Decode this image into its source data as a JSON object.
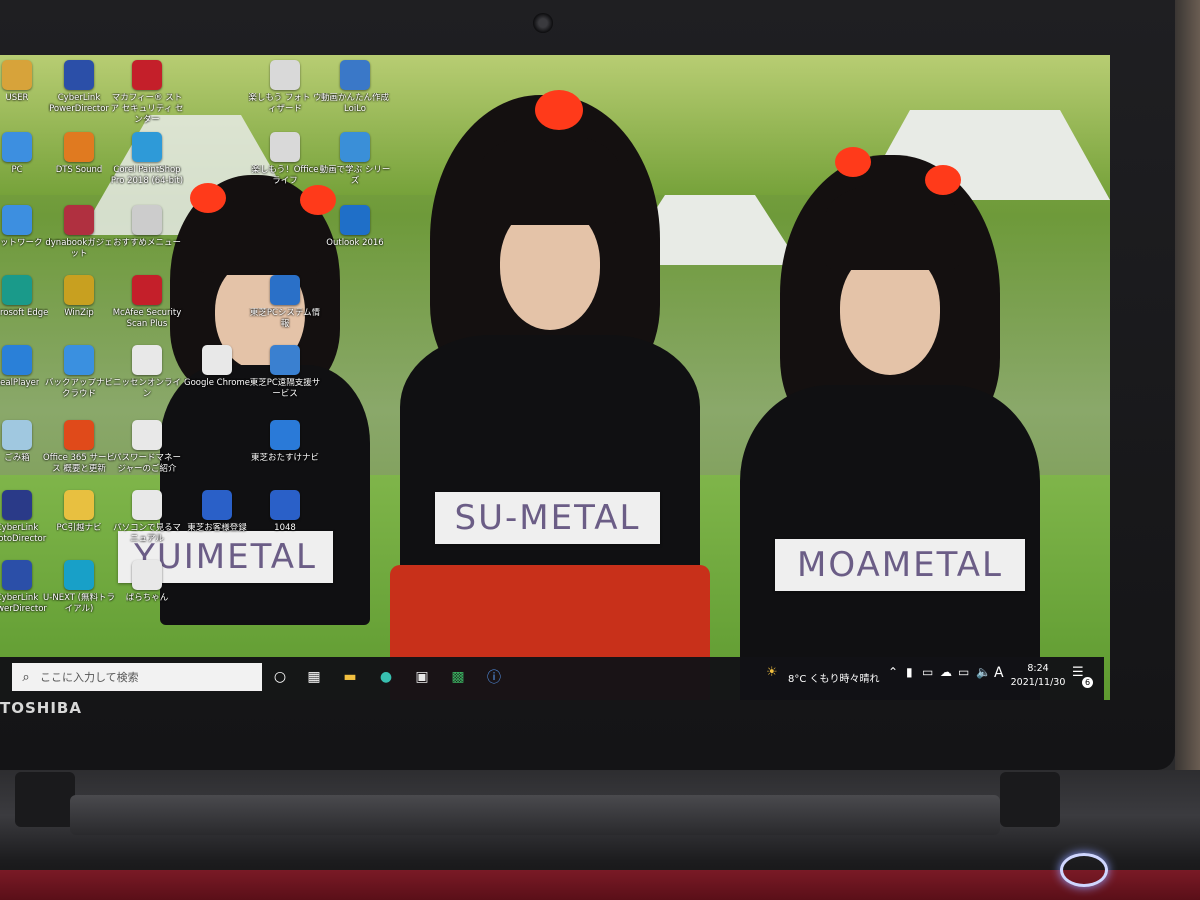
{
  "device": {
    "brand": "TOSHIBA"
  },
  "desktop": {
    "icons": [
      {
        "label": "USER",
        "icon": "user-folder-icon",
        "color": "#d7a33a"
      },
      {
        "label": "CyberLink PowerDirector",
        "icon": "powerdirector-icon",
        "color": "#2b4fa8"
      },
      {
        "label": "マカフィー® ストア セキュリティ センター",
        "icon": "mcafee-icon",
        "color": "#c41f2a"
      },
      {
        "label": "楽しもう フォト ウィザード",
        "icon": "photo-wizard-icon",
        "color": "#d9d9d9"
      },
      {
        "label": "動画かんたん作成 LoiLo",
        "icon": "loilo-icon",
        "color": "#3a78c8"
      },
      {
        "label": "PC",
        "icon": "pc-icon",
        "color": "#3d8fe0"
      },
      {
        "label": "DTS Sound",
        "icon": "dts-sound-icon",
        "color": "#e07a20"
      },
      {
        "label": "Corel PaintShop Pro 2018 (64-bit)",
        "icon": "paintshop-icon",
        "color": "#2e9ad8"
      },
      {
        "label": "楽しもう！Office ライフ",
        "icon": "office-life-icon",
        "color": "#d9d9d9"
      },
      {
        "label": "動画で学ぶ シリーズ",
        "icon": "video-learning-icon",
        "color": "#3a8fd8"
      },
      {
        "label": "ネットワーク",
        "icon": "network-icon",
        "color": "#3d8fe0"
      },
      {
        "label": "dynabookガジェット",
        "icon": "dynabook-gadget-icon",
        "color": "#b03040"
      },
      {
        "label": "おすすめメニュー",
        "icon": "recommend-menu-icon",
        "color": "#cccccc"
      },
      {
        "label": "Outlook 2016",
        "icon": "outlook-icon",
        "color": "#1f6fc8"
      },
      {
        "label": "Microsoft Edge",
        "icon": "edge-icon",
        "color": "#1a9a8a"
      },
      {
        "label": "WinZip",
        "icon": "winzip-icon",
        "color": "#c8a020"
      },
      {
        "label": "McAfee Security Scan Plus",
        "icon": "mcafee-scan-icon",
        "color": "#c41f2a"
      },
      {
        "label": "東芝PCシステム情報",
        "icon": "system-info-icon",
        "color": "#2a70c8"
      },
      {
        "label": "RealPlayer",
        "icon": "realplayer-icon",
        "color": "#2a80d8"
      },
      {
        "label": "バックアップナビ クラウド",
        "icon": "backup-navi-icon",
        "color": "#3a90e0"
      },
      {
        "label": "ニッセンオンライン",
        "icon": "nissen-icon",
        "color": "#e8e8e8"
      },
      {
        "label": "Google Chrome",
        "icon": "chrome-icon",
        "color": "#e8e8e8"
      },
      {
        "label": "東芝PC遠隔支援サービス",
        "icon": "remote-support-icon",
        "color": "#3a80d0"
      },
      {
        "label": "ごみ箱",
        "icon": "recycle-bin-icon",
        "color": "#a0c8e0"
      },
      {
        "label": "Office 365 サービス 概要と更新",
        "icon": "office365-icon",
        "color": "#e04a1a"
      },
      {
        "label": "パスワードマネージャーのご紹介",
        "icon": "password-manager-icon",
        "color": "#e8e8e8"
      },
      {
        "label": "東芝おたすけナビ",
        "icon": "otasuke-navi-icon",
        "color": "#2a7ad8"
      },
      {
        "label": "CyberLink PhotoDirector",
        "icon": "photodirector-icon",
        "color": "#2a3a88"
      },
      {
        "label": "PC引越ナビ",
        "icon": "pc-moving-navi-icon",
        "color": "#e8c040"
      },
      {
        "label": "1048",
        "icon": "key-icon",
        "color": "#2a60c8"
      },
      {
        "label": "パソコンで見るマニュアル",
        "icon": "manual-icon",
        "color": "#e8e8e8"
      },
      {
        "label": "東芝お客様登録",
        "icon": "registration-icon",
        "color": "#2a60c8"
      },
      {
        "label": "CyberLink PowerDirector",
        "icon": "powerdirector-icon",
        "color": "#2b4fa8"
      },
      {
        "label": "U-NEXT (無料トライアル)",
        "icon": "unext-icon",
        "color": "#18a0c8"
      },
      {
        "label": "ぱらちゃん",
        "icon": "parachan-icon",
        "color": "#e8e8e8"
      }
    ]
  },
  "wallpaper": {
    "signs": [
      "YUIMETAL",
      "SU-METAL",
      "MOAMETAL"
    ]
  },
  "taskbar": {
    "search_placeholder": "ここに入力して検索",
    "weather": "8°C くもり時々晴れ",
    "ime": "A",
    "time": "8:24",
    "date": "2021/11/30",
    "notifications": "6"
  }
}
